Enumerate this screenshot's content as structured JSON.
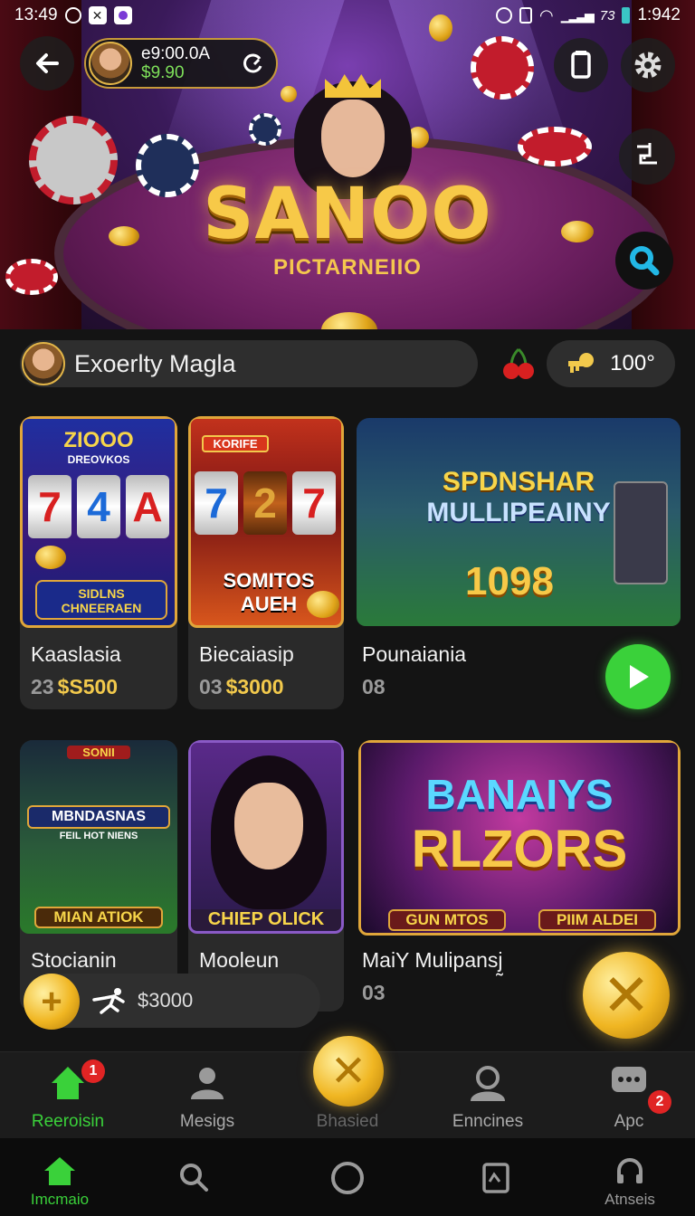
{
  "status_bar": {
    "time_left": "13:49",
    "time_right": "1:942",
    "network": "73"
  },
  "header": {
    "balance_line1": "e9:00.0A",
    "balance_line2": "$9.90",
    "hero_title": "SANOO",
    "hero_subtitle": "PICTARNEIIO"
  },
  "profile": {
    "name": "Exoerlty Magla",
    "score": "100°"
  },
  "games": [
    {
      "title": "Kaaslasia",
      "num": "23",
      "price": "$S500",
      "art_top": "ZIOOO",
      "art_sub": "DREOVKOS",
      "art_bottom": "SIDLNS CHNEERAEN",
      "reels": [
        "7",
        "4",
        "A"
      ]
    },
    {
      "title": "Biecaiasip",
      "num": "03",
      "price": "$3000",
      "art_tag": "KORIFE",
      "art_bottom": "SOMITOS AUEH",
      "reels": [
        "7",
        "2",
        "7"
      ]
    },
    {
      "title": "Pounaiania",
      "num": "08",
      "art_line1": "SPDNSHAR",
      "art_line2": "MULLIPEAINY",
      "art_number": "1098"
    },
    {
      "title": "Stocianin",
      "art_tag": "SONII",
      "art_line1": "MBNDASNAS",
      "art_line2": "FEIL HOT NIENS",
      "art_bottom": "MIAN ATIOK"
    },
    {
      "title": "Mooleun",
      "art_bottom": "CHIEP OLICK"
    },
    {
      "title": "MaiY Mulipansj̰",
      "num": "03",
      "art_line1": "BANAIYS",
      "art_line2": "RLZORS",
      "art_btn1": "GUN MTOS",
      "art_btn2": "PIIM ALDEI"
    }
  ],
  "float_bar": {
    "amount": "$3000"
  },
  "tabs": [
    {
      "label": "Reeroisin",
      "badge": "1"
    },
    {
      "label": "Mesigs"
    },
    {
      "label": "Bhasied"
    },
    {
      "label": "Enncines"
    },
    {
      "label": "Apc",
      "badge": "2"
    }
  ],
  "nav": [
    {
      "label": "Imcmaio"
    },
    {
      "label": ""
    },
    {
      "label": ""
    },
    {
      "label": ""
    },
    {
      "label": "Atnseis"
    }
  ],
  "colors": {
    "accent_green": "#3ad13a",
    "gold": "#f2c94c",
    "badge_red": "#e02424"
  }
}
